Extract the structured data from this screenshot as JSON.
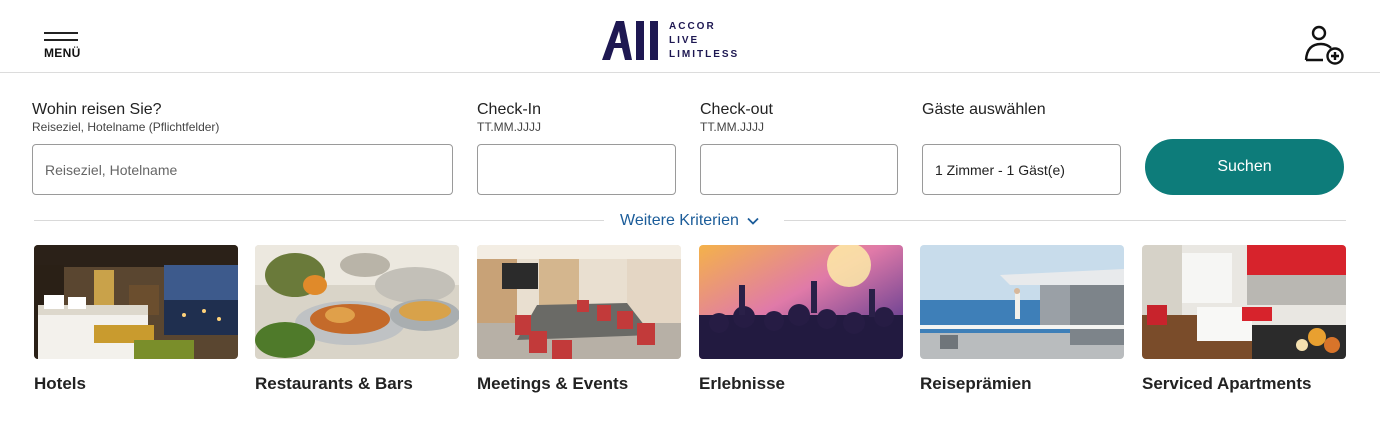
{
  "header": {
    "menu_label": "MENÜ",
    "logo": {
      "mark": "All",
      "lines": [
        "ACCOR",
        "LIVE",
        "LIMITLESS"
      ]
    },
    "account_icon": "user-plus-icon"
  },
  "search": {
    "destination": {
      "label": "Wohin reisen Sie?",
      "sublabel": "Reiseziel, Hotelname (Pflichtfelder)",
      "placeholder": "Reiseziel, Hotelname"
    },
    "checkin": {
      "label": "Check-In",
      "sublabel": "TT.MM.JJJJ",
      "value": ""
    },
    "checkout": {
      "label": "Check-out",
      "sublabel": "TT.MM.JJJJ",
      "value": ""
    },
    "guests": {
      "label": "Gäste auswählen",
      "value": "1 Zimmer - 1 Gäst(e)"
    },
    "submit_label": "Suchen",
    "more_criteria_label": "Weitere Kriterien"
  },
  "categories": [
    {
      "label": "Hotels",
      "image": "hotel-room-image"
    },
    {
      "label": "Restaurants & Bars",
      "image": "buffet-image"
    },
    {
      "label": "Meetings & Events",
      "image": "meeting-room-image"
    },
    {
      "label": "Erlebnisse",
      "image": "concert-crowd-image"
    },
    {
      "label": "Reiseprämien",
      "image": "seaside-terrace-image"
    },
    {
      "label": "Serviced Apartments",
      "image": "apartment-image"
    }
  ],
  "colors": {
    "accent": "#0d7c7a",
    "link": "#1b5c99",
    "brand": "#1e1852"
  }
}
